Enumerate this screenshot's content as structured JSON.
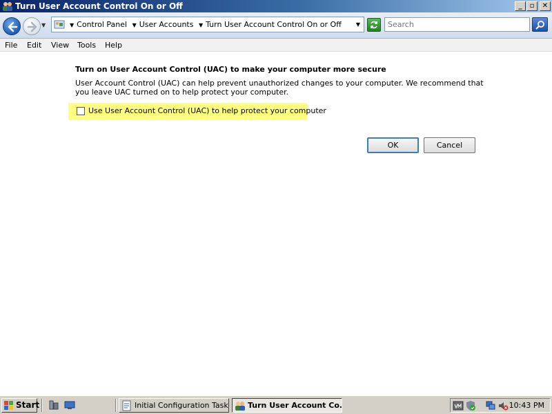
{
  "window": {
    "title": "Turn User Account Control On or Off",
    "minimize_glyph": "_",
    "maximize_glyph": "▫",
    "close_glyph": "✕"
  },
  "address_bar": {
    "breadcrumbs": [
      "Control Panel",
      "User Accounts",
      "Turn User Account Control On or Off"
    ],
    "search_placeholder": "Search"
  },
  "menu": {
    "items": [
      "File",
      "Edit",
      "View",
      "Tools",
      "Help"
    ]
  },
  "content": {
    "heading": "Turn on User Account Control (UAC) to make your computer more secure",
    "description": "User Account Control (UAC) can help prevent unauthorized changes to your computer.  We recommend that you leave UAC turned on to help protect your computer.",
    "checkbox_label": "Use User Account Control (UAC) to help protect your computer",
    "checkbox_checked": false,
    "ok_label": "OK",
    "cancel_label": "Cancel"
  },
  "taskbar": {
    "start_label": "Start",
    "tasks": [
      "Initial Configuration Tasks",
      "Turn User Account Co..."
    ],
    "active_task": 1,
    "clock": "10:43 PM"
  },
  "colors": {
    "highlight": "#ffff80",
    "title_bar": "#0a246a",
    "taskbar": "#d4d0c8"
  },
  "icons": {
    "app": "users-icon",
    "back": "back-arrow-icon",
    "forward": "forward-arrow-icon",
    "refresh": "refresh-icon",
    "search": "search-icon",
    "start": "windows-flag-icon"
  }
}
